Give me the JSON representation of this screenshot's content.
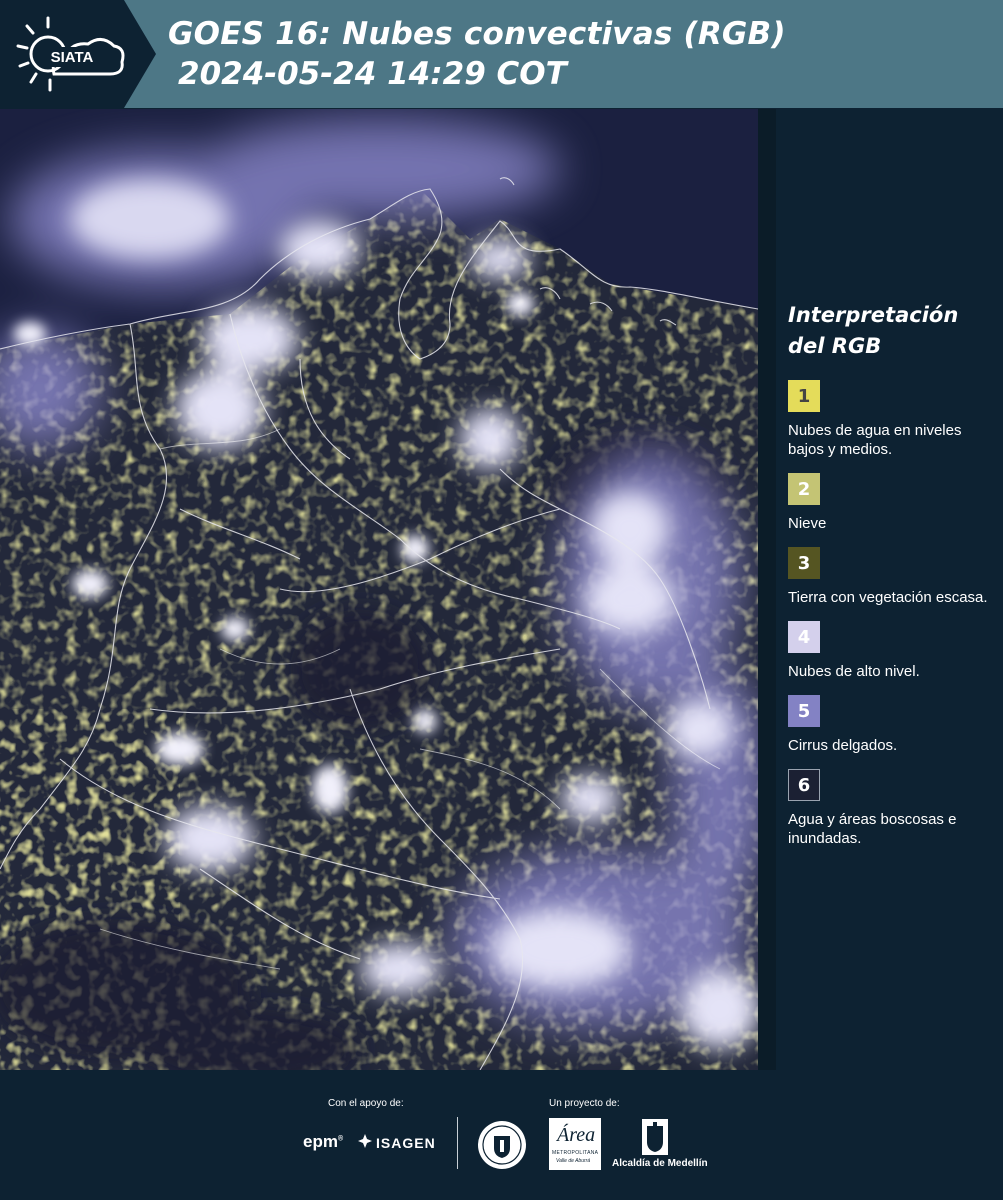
{
  "header": {
    "logo_text": "SIATA",
    "title_line1": "GOES 16: Nubes convectivas (RGB)",
    "title_line2": "2024-05-24 14:29 COT"
  },
  "map": {
    "base_color": "#1b2040",
    "colors": {
      "low_cloud": "#d6d45e",
      "high_cloud": "#dcdcf4",
      "cirrus": "#8482c4",
      "border_line": "#e8e8ee"
    }
  },
  "legend": {
    "title_line1": "Interpretación",
    "title_line2": "del RGB",
    "items": [
      {
        "number": "1",
        "color": "#e4dc5a",
        "text_color": "#444444",
        "label": "Nubes de agua en niveles bajos y medios."
      },
      {
        "number": "2",
        "color": "#c4c474",
        "text_color": "#ffffff",
        "label": "Nieve"
      },
      {
        "number": "3",
        "color": "#555522",
        "text_color": "#ffffff",
        "label": "Tierra con vegetación escasa."
      },
      {
        "number": "4",
        "color": "#d4d0ec",
        "text_color": "#ffffff",
        "label": "Nubes de alto nivel."
      },
      {
        "number": "5",
        "color": "#8382c4",
        "text_color": "#ffffff",
        "label": "Cirrus delgados."
      },
      {
        "number": "6",
        "color": "#1b2033",
        "text_color": "#ffffff",
        "label": "Agua y áreas boscosas e inundadas."
      }
    ]
  },
  "footer": {
    "support_label": "Con el apoyo de:",
    "project_label": "Un proyecto de:",
    "epm": "epm",
    "isagen": "ISAGEN",
    "area_logo_a": "Área",
    "area_logo_line1": "METROPOLITANA",
    "area_logo_line2": "Valle de Aburrá",
    "alcaldia": "Alcaldía de Medellín"
  }
}
